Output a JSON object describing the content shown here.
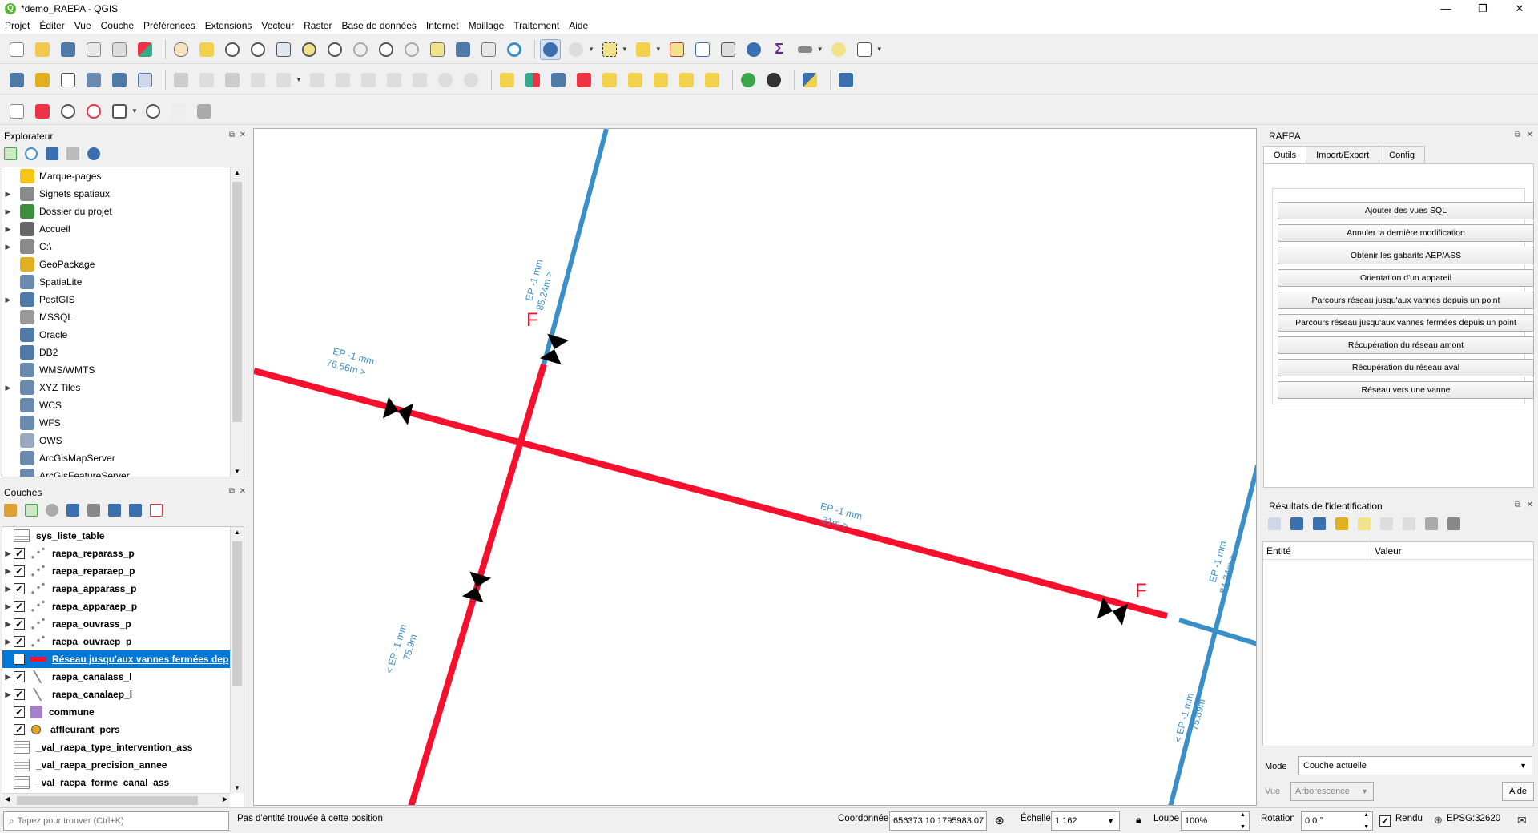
{
  "window": {
    "title": "*demo_RAEPA - QGIS",
    "app_icon": "Q",
    "controls": [
      "—",
      "❐",
      "✕"
    ]
  },
  "menu": [
    "Projet",
    "Éditer",
    "Vue",
    "Couche",
    "Préférences",
    "Extensions",
    "Vecteur",
    "Raster",
    "Base de données",
    "Internet",
    "Maillage",
    "Traitement",
    "Aide"
  ],
  "explorer": {
    "title": "Explorateur",
    "items": [
      {
        "label": "Marque-pages",
        "icon": "star-icon",
        "color": "#f5c518",
        "expandable": false
      },
      {
        "label": "Signets spatiaux",
        "icon": "bookmark-icon",
        "color": "#8a8a8a",
        "expandable": true
      },
      {
        "label": "Dossier du projet",
        "icon": "project-folder-icon",
        "color": "#3d8f3d",
        "expandable": true
      },
      {
        "label": "Accueil",
        "icon": "home-icon",
        "color": "#666666",
        "expandable": true
      },
      {
        "label": "C:\\",
        "icon": "drive-icon",
        "color": "#8a8a8a",
        "expandable": true
      },
      {
        "label": "GeoPackage",
        "icon": "geopackage-icon",
        "color": "#e0b020",
        "expandable": false
      },
      {
        "label": "SpatiaLite",
        "icon": "spatialite-icon",
        "color": "#6a8ab0",
        "expandable": false
      },
      {
        "label": "PostGIS",
        "icon": "postgis-icon",
        "color": "#4f7aa8",
        "expandable": true
      },
      {
        "label": "MSSQL",
        "icon": "mssql-icon",
        "color": "#9a9a9a",
        "expandable": false
      },
      {
        "label": "Oracle",
        "icon": "oracle-icon",
        "color": "#4f7aa8",
        "expandable": false
      },
      {
        "label": "DB2",
        "icon": "db2-icon",
        "color": "#4f7aa8",
        "expandable": false
      },
      {
        "label": "WMS/WMTS",
        "icon": "wms-icon",
        "color": "#6a8ab0",
        "expandable": false
      },
      {
        "label": "XYZ Tiles",
        "icon": "xyz-icon",
        "color": "#6a8ab0",
        "expandable": true
      },
      {
        "label": "WCS",
        "icon": "wcs-icon",
        "color": "#6a8ab0",
        "expandable": false
      },
      {
        "label": "WFS",
        "icon": "wfs-icon",
        "color": "#6a8ab0",
        "expandable": false
      },
      {
        "label": "OWS",
        "icon": "ows-icon",
        "color": "#9aa8c0",
        "expandable": false
      },
      {
        "label": "ArcGisMapServer",
        "icon": "arcgis-map-icon",
        "color": "#6a8ab0",
        "expandable": false
      },
      {
        "label": "ArcGisFeatureServer",
        "icon": "arcgis-feature-icon",
        "color": "#6a8ab0",
        "expandable": false
      }
    ]
  },
  "layers": {
    "title": "Couches",
    "items": [
      {
        "label": "sys_liste_table",
        "sym": "table",
        "checked": false,
        "expandable": false,
        "selected": false
      },
      {
        "label": "raepa_reparass_p",
        "sym": "points",
        "checked": true,
        "expandable": true,
        "selected": false
      },
      {
        "label": "raepa_reparaep_p",
        "sym": "points",
        "checked": true,
        "expandable": true,
        "selected": false
      },
      {
        "label": "raepa_apparass_p",
        "sym": "points",
        "checked": true,
        "expandable": true,
        "selected": false
      },
      {
        "label": "raepa_apparaep_p",
        "sym": "points",
        "checked": true,
        "expandable": true,
        "selected": false
      },
      {
        "label": "raepa_ouvrass_p",
        "sym": "points",
        "checked": true,
        "expandable": true,
        "selected": false
      },
      {
        "label": "raepa_ouvraep_p",
        "sym": "points",
        "checked": true,
        "expandable": true,
        "selected": false
      },
      {
        "label": "Réseau jusqu'aux vannes fermées dep",
        "sym": "redline",
        "checked": true,
        "expandable": false,
        "selected": true
      },
      {
        "label": "raepa_canalass_l",
        "sym": "lines",
        "checked": true,
        "expandable": true,
        "selected": false
      },
      {
        "label": "raepa_canalaep_l",
        "sym": "lines",
        "checked": true,
        "expandable": true,
        "selected": false
      },
      {
        "label": "commune",
        "sym": "polygon",
        "checked": true,
        "expandable": false,
        "selected": false
      },
      {
        "label": "affleurant_pcrs",
        "sym": "circle",
        "checked": true,
        "expandable": false,
        "selected": false
      },
      {
        "label": "_val_raepa_type_intervention_ass",
        "sym": "table",
        "checked": false,
        "expandable": false,
        "selected": false
      },
      {
        "label": "_val_raepa_precision_annee",
        "sym": "table",
        "checked": false,
        "expandable": false,
        "selected": false
      },
      {
        "label": "_val_raepa_forme_canal_ass",
        "sym": "table",
        "checked": false,
        "expandable": false,
        "selected": false
      }
    ]
  },
  "raepa": {
    "title": "RAEPA",
    "tabs": [
      "Outils",
      "Import/Export",
      "Config"
    ],
    "buttons": [
      "Ajouter des vues SQL",
      "Annuler la dernière modification",
      "Obtenir les gabarits AEP/ASS",
      "Orientation d'un appareil",
      "Parcours réseau jusqu'aux vannes depuis un point",
      "Parcours réseau jusqu'aux vannes fermées depuis un point",
      "Récupération du réseau amont",
      "Récupération du réseau aval",
      "Réseau vers une vanne"
    ]
  },
  "identify": {
    "title": "Résultats de l'identification",
    "col_entity": "Entité",
    "col_value": "Valeur",
    "mode_label": "Mode",
    "mode_value": "Couche actuelle",
    "view_label": "Vue",
    "view_value": "Arborescence",
    "help_button": "Aide"
  },
  "map": {
    "labels": [
      {
        "text1": "EP -1 mm",
        "text2": "85.24m  >"
      },
      {
        "text1": "EP -1 mm",
        "text2": "76.56m  >"
      },
      {
        "text1": "EP -1 mm",
        "text2": "31m  >"
      },
      {
        "text1": "< EP -1 mm",
        "text2": "75.9m"
      },
      {
        "text1": "EP -1 mm",
        "text2": "84.34m  >"
      },
      {
        "text1": "< EP -1 mm",
        "text2": "75.89m"
      }
    ],
    "valve_marker": "F",
    "red_color": "#f5102e",
    "blue_color": "#3a8fc8",
    "label_color": "#3a8fc8"
  },
  "status": {
    "search_placeholder": "Tapez pour trouver (Ctrl+K)",
    "message": "Pas d'entité trouvée à cette position.",
    "coord_label": "Coordonnée",
    "coord_value": "656373.10,1795983.07",
    "scale_label": "Échelle",
    "scale_value": "1:162",
    "magnifier_label": "Loupe",
    "magnifier_value": "100%",
    "rotation_label": "Rotation",
    "rotation_value": "0,0 °",
    "render_label": "Rendu",
    "crs": "EPSG:32620"
  }
}
